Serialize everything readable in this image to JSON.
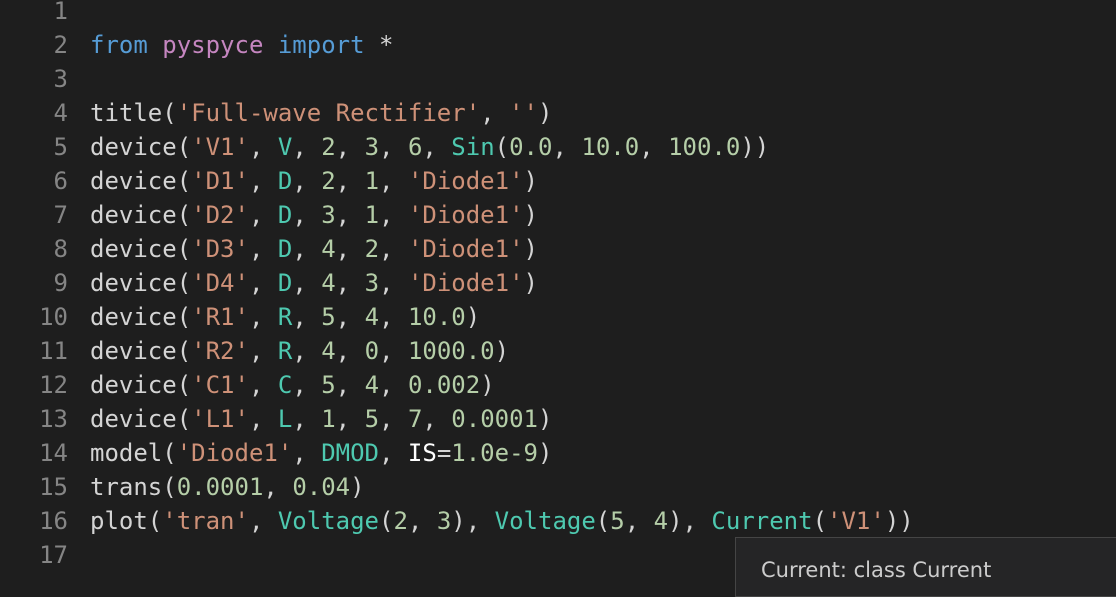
{
  "editor": {
    "lines": [
      {
        "n": "1",
        "tokens": []
      },
      {
        "n": "2",
        "tokens": [
          {
            "t": "from",
            "c": "kw"
          },
          {
            "t": " ",
            "c": "p"
          },
          {
            "t": "pyspyce",
            "c": "mod"
          },
          {
            "t": " ",
            "c": "p"
          },
          {
            "t": "import",
            "c": "kw"
          },
          {
            "t": " *",
            "c": "p"
          }
        ]
      },
      {
        "n": "3",
        "tokens": []
      },
      {
        "n": "4",
        "tokens": [
          {
            "t": "title(",
            "c": "p"
          },
          {
            "t": "'Full-wave Rectifier'",
            "c": "str"
          },
          {
            "t": ", ",
            "c": "p"
          },
          {
            "t": "''",
            "c": "str"
          },
          {
            "t": ")",
            "c": "p"
          }
        ]
      },
      {
        "n": "5",
        "tokens": [
          {
            "t": "device(",
            "c": "p"
          },
          {
            "t": "'V1'",
            "c": "str"
          },
          {
            "t": ", ",
            "c": "p"
          },
          {
            "t": "V",
            "c": "cls"
          },
          {
            "t": ", ",
            "c": "p"
          },
          {
            "t": "2",
            "c": "num"
          },
          {
            "t": ", ",
            "c": "p"
          },
          {
            "t": "3",
            "c": "num"
          },
          {
            "t": ", ",
            "c": "p"
          },
          {
            "t": "6",
            "c": "num"
          },
          {
            "t": ", ",
            "c": "p"
          },
          {
            "t": "Sin",
            "c": "cls"
          },
          {
            "t": "(",
            "c": "p"
          },
          {
            "t": "0.0",
            "c": "num"
          },
          {
            "t": ", ",
            "c": "p"
          },
          {
            "t": "10.0",
            "c": "num"
          },
          {
            "t": ", ",
            "c": "p"
          },
          {
            "t": "100.0",
            "c": "num"
          },
          {
            "t": "))",
            "c": "p"
          }
        ]
      },
      {
        "n": "6",
        "tokens": [
          {
            "t": "device(",
            "c": "p"
          },
          {
            "t": "'D1'",
            "c": "str"
          },
          {
            "t": ", ",
            "c": "p"
          },
          {
            "t": "D",
            "c": "cls"
          },
          {
            "t": ", ",
            "c": "p"
          },
          {
            "t": "2",
            "c": "num"
          },
          {
            "t": ", ",
            "c": "p"
          },
          {
            "t": "1",
            "c": "num"
          },
          {
            "t": ", ",
            "c": "p"
          },
          {
            "t": "'Diode1'",
            "c": "str"
          },
          {
            "t": ")",
            "c": "p"
          }
        ]
      },
      {
        "n": "7",
        "tokens": [
          {
            "t": "device(",
            "c": "p"
          },
          {
            "t": "'D2'",
            "c": "str"
          },
          {
            "t": ", ",
            "c": "p"
          },
          {
            "t": "D",
            "c": "cls"
          },
          {
            "t": ", ",
            "c": "p"
          },
          {
            "t": "3",
            "c": "num"
          },
          {
            "t": ", ",
            "c": "p"
          },
          {
            "t": "1",
            "c": "num"
          },
          {
            "t": ", ",
            "c": "p"
          },
          {
            "t": "'Diode1'",
            "c": "str"
          },
          {
            "t": ")",
            "c": "p"
          }
        ]
      },
      {
        "n": "8",
        "tokens": [
          {
            "t": "device(",
            "c": "p"
          },
          {
            "t": "'D3'",
            "c": "str"
          },
          {
            "t": ", ",
            "c": "p"
          },
          {
            "t": "D",
            "c": "cls"
          },
          {
            "t": ", ",
            "c": "p"
          },
          {
            "t": "4",
            "c": "num"
          },
          {
            "t": ", ",
            "c": "p"
          },
          {
            "t": "2",
            "c": "num"
          },
          {
            "t": ", ",
            "c": "p"
          },
          {
            "t": "'Diode1'",
            "c": "str"
          },
          {
            "t": ")",
            "c": "p"
          }
        ]
      },
      {
        "n": "9",
        "tokens": [
          {
            "t": "device(",
            "c": "p"
          },
          {
            "t": "'D4'",
            "c": "str"
          },
          {
            "t": ", ",
            "c": "p"
          },
          {
            "t": "D",
            "c": "cls"
          },
          {
            "t": ", ",
            "c": "p"
          },
          {
            "t": "4",
            "c": "num"
          },
          {
            "t": ", ",
            "c": "p"
          },
          {
            "t": "3",
            "c": "num"
          },
          {
            "t": ", ",
            "c": "p"
          },
          {
            "t": "'Diode1'",
            "c": "str"
          },
          {
            "t": ")",
            "c": "p"
          }
        ]
      },
      {
        "n": "10",
        "tokens": [
          {
            "t": "device(",
            "c": "p"
          },
          {
            "t": "'R1'",
            "c": "str"
          },
          {
            "t": ", ",
            "c": "p"
          },
          {
            "t": "R",
            "c": "cls"
          },
          {
            "t": ", ",
            "c": "p"
          },
          {
            "t": "5",
            "c": "num"
          },
          {
            "t": ", ",
            "c": "p"
          },
          {
            "t": "4",
            "c": "num"
          },
          {
            "t": ", ",
            "c": "p"
          },
          {
            "t": "10.0",
            "c": "num"
          },
          {
            "t": ")",
            "c": "p"
          }
        ]
      },
      {
        "n": "11",
        "tokens": [
          {
            "t": "device(",
            "c": "p"
          },
          {
            "t": "'R2'",
            "c": "str"
          },
          {
            "t": ", ",
            "c": "p"
          },
          {
            "t": "R",
            "c": "cls"
          },
          {
            "t": ", ",
            "c": "p"
          },
          {
            "t": "4",
            "c": "num"
          },
          {
            "t": ", ",
            "c": "p"
          },
          {
            "t": "0",
            "c": "num"
          },
          {
            "t": ", ",
            "c": "p"
          },
          {
            "t": "1000.0",
            "c": "num"
          },
          {
            "t": ")",
            "c": "p"
          }
        ]
      },
      {
        "n": "12",
        "tokens": [
          {
            "t": "device(",
            "c": "p"
          },
          {
            "t": "'C1'",
            "c": "str"
          },
          {
            "t": ", ",
            "c": "p"
          },
          {
            "t": "C",
            "c": "cls"
          },
          {
            "t": ", ",
            "c": "p"
          },
          {
            "t": "5",
            "c": "num"
          },
          {
            "t": ", ",
            "c": "p"
          },
          {
            "t": "4",
            "c": "num"
          },
          {
            "t": ", ",
            "c": "p"
          },
          {
            "t": "0.002",
            "c": "num"
          },
          {
            "t": ")",
            "c": "p"
          }
        ]
      },
      {
        "n": "13",
        "tokens": [
          {
            "t": "device(",
            "c": "p"
          },
          {
            "t": "'L1'",
            "c": "str"
          },
          {
            "t": ", ",
            "c": "p"
          },
          {
            "t": "L",
            "c": "cls"
          },
          {
            "t": ", ",
            "c": "p"
          },
          {
            "t": "1",
            "c": "num"
          },
          {
            "t": ", ",
            "c": "p"
          },
          {
            "t": "5",
            "c": "num"
          },
          {
            "t": ", ",
            "c": "p"
          },
          {
            "t": "7",
            "c": "num"
          },
          {
            "t": ", ",
            "c": "p"
          },
          {
            "t": "0.0001",
            "c": "num"
          },
          {
            "t": ")",
            "c": "p"
          }
        ]
      },
      {
        "n": "14",
        "tokens": [
          {
            "t": "model(",
            "c": "p"
          },
          {
            "t": "'Diode1'",
            "c": "str"
          },
          {
            "t": ", ",
            "c": "p"
          },
          {
            "t": "DMOD",
            "c": "cls"
          },
          {
            "t": ", ",
            "c": "p"
          },
          {
            "t": "IS",
            "c": "param"
          },
          {
            "t": "=",
            "c": "p"
          },
          {
            "t": "1.0e-9",
            "c": "num"
          },
          {
            "t": ")",
            "c": "p"
          }
        ]
      },
      {
        "n": "15",
        "tokens": [
          {
            "t": "trans(",
            "c": "p"
          },
          {
            "t": "0.0001",
            "c": "num"
          },
          {
            "t": ", ",
            "c": "p"
          },
          {
            "t": "0.04",
            "c": "num"
          },
          {
            "t": ")",
            "c": "p"
          }
        ]
      },
      {
        "n": "16",
        "tokens": [
          {
            "t": "plot(",
            "c": "p"
          },
          {
            "t": "'tran'",
            "c": "str"
          },
          {
            "t": ", ",
            "c": "p"
          },
          {
            "t": "Voltage",
            "c": "cls"
          },
          {
            "t": "(",
            "c": "p"
          },
          {
            "t": "2",
            "c": "num"
          },
          {
            "t": ", ",
            "c": "p"
          },
          {
            "t": "3",
            "c": "num"
          },
          {
            "t": "), ",
            "c": "p"
          },
          {
            "t": "Voltage",
            "c": "cls"
          },
          {
            "t": "(",
            "c": "p"
          },
          {
            "t": "5",
            "c": "num"
          },
          {
            "t": ", ",
            "c": "p"
          },
          {
            "t": "4",
            "c": "num"
          },
          {
            "t": "), ",
            "c": "p"
          },
          {
            "t": "Current",
            "c": "cls"
          },
          {
            "t": "(",
            "c": "p"
          },
          {
            "t": "'V1'",
            "c": "str"
          },
          {
            "t": "))",
            "c": "p"
          }
        ]
      },
      {
        "n": "17",
        "tokens": []
      }
    ]
  },
  "hover": {
    "text": "Current: class Current"
  },
  "colors": {
    "background": "#1e1e1e",
    "keyword": "#569cd6",
    "module": "#c586c0",
    "string": "#ce9178",
    "number": "#b5cea8",
    "class": "#4ec9b0"
  }
}
